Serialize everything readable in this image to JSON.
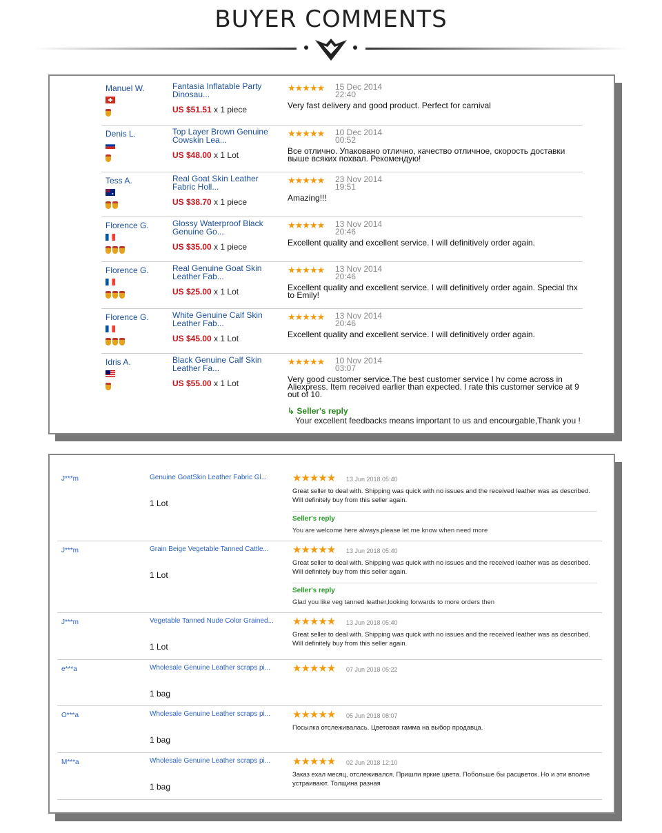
{
  "header": {
    "title": "BUYER COMMENTS"
  },
  "panel1": {
    "reviews": [
      {
        "name": "Manuel W.",
        "product": "Fantasia Inflatable Party Dinosau...",
        "price": "US $51.51",
        "qty": "x 1 piece",
        "stars": "★★★★★",
        "date": "15 Dec 2014 22:40",
        "comment": "Very fast delivery and good product. Perfect for carnival",
        "medals": 1
      },
      {
        "name": "Denis L.",
        "product": "Top Layer Brown Genuine Cowskin Lea...",
        "price": "US $48.00",
        "qty": "x 1 Lot",
        "stars": "★★★★★",
        "date": "10 Dec 2014 00:52",
        "comment": "Все отлично. Упаковано отлично, качество отличное, скорость доставки выше всяких похвал. Рекомендую!",
        "medals": 1
      },
      {
        "name": "Tess A.",
        "product": "Real Goat Skin Leather Fabric Holl...",
        "price": "US $38.70",
        "qty": "x 1 piece",
        "stars": "★★★★★",
        "date": "23 Nov 2014 19:51",
        "comment": "Amazing!!!",
        "medals": 2
      },
      {
        "name": "Florence G.",
        "product": "Glossy Waterproof Black Genuine Go...",
        "price": "US $35.00",
        "qty": "x 1 piece",
        "stars": "★★★★★",
        "date": "13 Nov 2014 20:46",
        "comment": "Excellent quality and excellent service. I will definitively order again.",
        "medals": 3
      },
      {
        "name": "Florence G.",
        "product": "Real Genuine Goat Skin Leather Fab...",
        "price": "US $25.00",
        "qty": "x 1 Lot",
        "stars": "★★★★★",
        "date": "13 Nov 2014 20:46",
        "comment": "Excellent quality and excellent service. I will definitively order again. Special thx to Emily!",
        "medals": 3
      },
      {
        "name": "Florence G.",
        "product": "White Genuine Calf Skin Leather Fab...",
        "price": "US $45.00",
        "qty": "x 1 Lot",
        "stars": "★★★★★",
        "date": "13 Nov 2014 20:46",
        "comment": "Excellent quality and excellent service. I will definitively order again.",
        "medals": 3
      },
      {
        "name": "Idris A.",
        "product": "Black Genuine Calf Skin Leather Fa...",
        "price": "US $55.00",
        "qty": "x 1 Lot",
        "stars": "★★★★★",
        "date": "10 Nov 2014 03:07",
        "comment": "Very good customer service.The best customer service I hv come across in Aliexpress. Item received earlier than expected. I rate this customer service at 9 out of 10.",
        "reply_label": "Seller's reply",
        "reply": "Your excellent feedbacks means important to us and encourgable,Thank you !",
        "medals": 1
      }
    ]
  },
  "panel2": {
    "reviews": [
      {
        "name": "J***m",
        "product": "Genuine GoatSkin Leather Fabric Gl...",
        "qty": "1 Lot",
        "stars": "★★★★★",
        "date": "13 Jun 2018 05:40",
        "comment": "Great seller to deal with. Shipping was quick with no issues and the received leather was as described. Will definitely buy from this seller again.",
        "reply_label": "Seller's reply",
        "reply": "You are welcome here always,please let me know when need more"
      },
      {
        "name": "J***m",
        "product": "Grain Beige Vegetable Tanned Cattle...",
        "qty": "1 Lot",
        "stars": "★★★★★",
        "date": "13 Jun 2018 05:40",
        "comment": "Great seller to deal with. Shipping was quick with no issues and the received leather was as described. Will definitely buy from this seller again.",
        "reply_label": "Seller's reply",
        "reply": "Glad you like veg tanned leather,looking forwards to more orders then"
      },
      {
        "name": "J***m",
        "product": "Vegetable Tanned Nude Color Grained...",
        "qty": "1 Lot",
        "stars": "★★★★★",
        "date": "13 Jun 2018 05:40",
        "comment": "Great seller to deal with. Shipping was quick with no issues and the received leather was as described. Will definitely buy from this seller again."
      },
      {
        "name": "e***a",
        "product": "Wholesale Genuine Leather scraps pi...",
        "qty": "1 bag",
        "stars": "★★★★★",
        "date": "07 Jun 2018 05:22",
        "comment": ""
      },
      {
        "name": "O***a",
        "product": "Wholesale Genuine Leather scraps pi...",
        "qty": "1 bag",
        "stars": "★★★★★",
        "date": "05 Jun 2018 08:07",
        "comment": "Посылка отслеживалась. Цветовая гамма на выбор продавца."
      },
      {
        "name": "M***a",
        "product": "Wholesale Genuine Leather scraps pi...",
        "qty": "1 bag",
        "stars": "★★★★★",
        "date": "02 Jun 2018 12:10",
        "comment": "Заказ ехал месяц, отслеживался. Пришли яркие цвета. Побольше бы расцветок. Но и эти вполне устраивают. Толщина разная"
      }
    ]
  }
}
